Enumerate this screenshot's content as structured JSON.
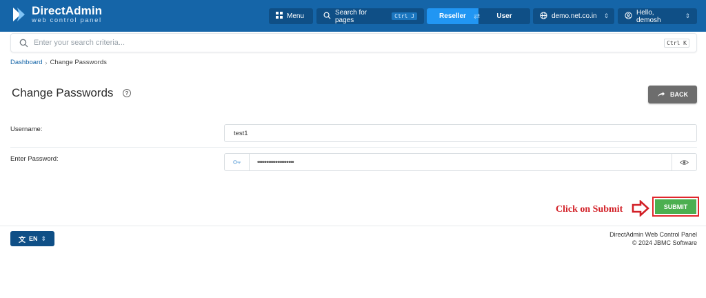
{
  "header": {
    "brand_title": "DirectAdmin",
    "brand_subtitle": "web control panel",
    "menu_label": "Menu",
    "search_pages_label": "Search for pages",
    "search_pages_shortcut": "Ctrl J",
    "toggle": {
      "active": "Reseller",
      "inactive": "User"
    },
    "domain": "demo.net.co.in",
    "user_greeting": "Hello, demosh",
    "colors": {
      "bar": "#1565a8",
      "button": "#0f4f86",
      "active": "#2196f3"
    }
  },
  "search": {
    "placeholder": "Enter your search criteria...",
    "shortcut": "Ctrl K"
  },
  "breadcrumb": {
    "root": "Dashboard",
    "current": "Change Passwords"
  },
  "page": {
    "title": "Change Passwords",
    "back_label": "BACK"
  },
  "form": {
    "username_label": "Username:",
    "username_value": "test1",
    "password_label": "Enter Password:",
    "password_masked": "••••••••••••••••••••"
  },
  "annotation": {
    "text": "Click on Submit",
    "color": "#d21f26"
  },
  "actions": {
    "submit_label": "SUBMIT",
    "submit_color": "#4caf50"
  },
  "footer": {
    "language": "EN",
    "product": "DirectAdmin Web Control Panel",
    "copyright": "© 2024 JBMC Software"
  },
  "icons": [
    "directadmin-logo-icon",
    "menu-grid-icon",
    "search-icon",
    "swap-icon",
    "globe-icon",
    "user-circle-icon",
    "chevron-updown-icon",
    "help-icon",
    "back-arrow-icon",
    "key-icon",
    "eye-icon",
    "translate-icon",
    "red-arrow-icon"
  ]
}
